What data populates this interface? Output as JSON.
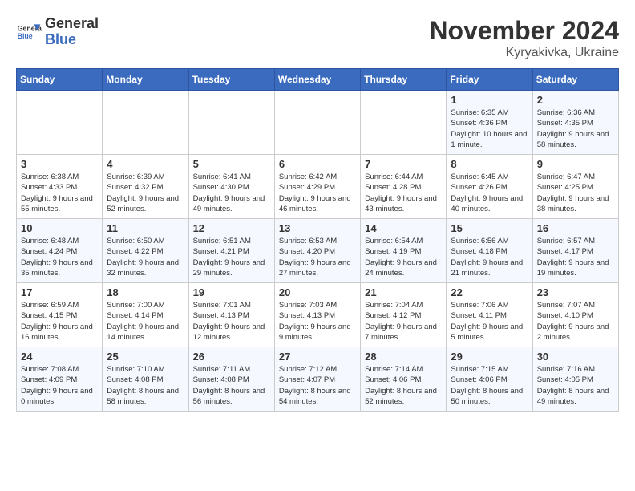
{
  "header": {
    "logo_line1": "General",
    "logo_line2": "Blue",
    "month_title": "November 2024",
    "location": "Kyryakivka, Ukraine"
  },
  "days_of_week": [
    "Sunday",
    "Monday",
    "Tuesday",
    "Wednesday",
    "Thursday",
    "Friday",
    "Saturday"
  ],
  "weeks": [
    [
      {
        "day": "",
        "info": ""
      },
      {
        "day": "",
        "info": ""
      },
      {
        "day": "",
        "info": ""
      },
      {
        "day": "",
        "info": ""
      },
      {
        "day": "",
        "info": ""
      },
      {
        "day": "1",
        "info": "Sunrise: 6:35 AM\nSunset: 4:36 PM\nDaylight: 10 hours and 1 minute."
      },
      {
        "day": "2",
        "info": "Sunrise: 6:36 AM\nSunset: 4:35 PM\nDaylight: 9 hours and 58 minutes."
      }
    ],
    [
      {
        "day": "3",
        "info": "Sunrise: 6:38 AM\nSunset: 4:33 PM\nDaylight: 9 hours and 55 minutes."
      },
      {
        "day": "4",
        "info": "Sunrise: 6:39 AM\nSunset: 4:32 PM\nDaylight: 9 hours and 52 minutes."
      },
      {
        "day": "5",
        "info": "Sunrise: 6:41 AM\nSunset: 4:30 PM\nDaylight: 9 hours and 49 minutes."
      },
      {
        "day": "6",
        "info": "Sunrise: 6:42 AM\nSunset: 4:29 PM\nDaylight: 9 hours and 46 minutes."
      },
      {
        "day": "7",
        "info": "Sunrise: 6:44 AM\nSunset: 4:28 PM\nDaylight: 9 hours and 43 minutes."
      },
      {
        "day": "8",
        "info": "Sunrise: 6:45 AM\nSunset: 4:26 PM\nDaylight: 9 hours and 40 minutes."
      },
      {
        "day": "9",
        "info": "Sunrise: 6:47 AM\nSunset: 4:25 PM\nDaylight: 9 hours and 38 minutes."
      }
    ],
    [
      {
        "day": "10",
        "info": "Sunrise: 6:48 AM\nSunset: 4:24 PM\nDaylight: 9 hours and 35 minutes."
      },
      {
        "day": "11",
        "info": "Sunrise: 6:50 AM\nSunset: 4:22 PM\nDaylight: 9 hours and 32 minutes."
      },
      {
        "day": "12",
        "info": "Sunrise: 6:51 AM\nSunset: 4:21 PM\nDaylight: 9 hours and 29 minutes."
      },
      {
        "day": "13",
        "info": "Sunrise: 6:53 AM\nSunset: 4:20 PM\nDaylight: 9 hours and 27 minutes."
      },
      {
        "day": "14",
        "info": "Sunrise: 6:54 AM\nSunset: 4:19 PM\nDaylight: 9 hours and 24 minutes."
      },
      {
        "day": "15",
        "info": "Sunrise: 6:56 AM\nSunset: 4:18 PM\nDaylight: 9 hours and 21 minutes."
      },
      {
        "day": "16",
        "info": "Sunrise: 6:57 AM\nSunset: 4:17 PM\nDaylight: 9 hours and 19 minutes."
      }
    ],
    [
      {
        "day": "17",
        "info": "Sunrise: 6:59 AM\nSunset: 4:15 PM\nDaylight: 9 hours and 16 minutes."
      },
      {
        "day": "18",
        "info": "Sunrise: 7:00 AM\nSunset: 4:14 PM\nDaylight: 9 hours and 14 minutes."
      },
      {
        "day": "19",
        "info": "Sunrise: 7:01 AM\nSunset: 4:13 PM\nDaylight: 9 hours and 12 minutes."
      },
      {
        "day": "20",
        "info": "Sunrise: 7:03 AM\nSunset: 4:13 PM\nDaylight: 9 hours and 9 minutes."
      },
      {
        "day": "21",
        "info": "Sunrise: 7:04 AM\nSunset: 4:12 PM\nDaylight: 9 hours and 7 minutes."
      },
      {
        "day": "22",
        "info": "Sunrise: 7:06 AM\nSunset: 4:11 PM\nDaylight: 9 hours and 5 minutes."
      },
      {
        "day": "23",
        "info": "Sunrise: 7:07 AM\nSunset: 4:10 PM\nDaylight: 9 hours and 2 minutes."
      }
    ],
    [
      {
        "day": "24",
        "info": "Sunrise: 7:08 AM\nSunset: 4:09 PM\nDaylight: 9 hours and 0 minutes."
      },
      {
        "day": "25",
        "info": "Sunrise: 7:10 AM\nSunset: 4:08 PM\nDaylight: 8 hours and 58 minutes."
      },
      {
        "day": "26",
        "info": "Sunrise: 7:11 AM\nSunset: 4:08 PM\nDaylight: 8 hours and 56 minutes."
      },
      {
        "day": "27",
        "info": "Sunrise: 7:12 AM\nSunset: 4:07 PM\nDaylight: 8 hours and 54 minutes."
      },
      {
        "day": "28",
        "info": "Sunrise: 7:14 AM\nSunset: 4:06 PM\nDaylight: 8 hours and 52 minutes."
      },
      {
        "day": "29",
        "info": "Sunrise: 7:15 AM\nSunset: 4:06 PM\nDaylight: 8 hours and 50 minutes."
      },
      {
        "day": "30",
        "info": "Sunrise: 7:16 AM\nSunset: 4:05 PM\nDaylight: 8 hours and 49 minutes."
      }
    ]
  ]
}
